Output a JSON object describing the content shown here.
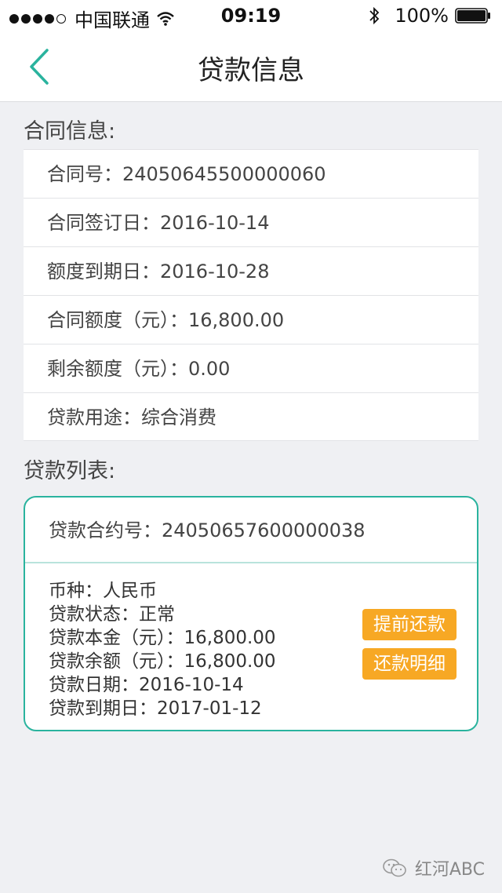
{
  "status_bar": {
    "carrier": "中国联通",
    "time": "09:19",
    "battery": "100%"
  },
  "nav": {
    "title": "贷款信息"
  },
  "contract": {
    "section_title": "合同信息:",
    "rows": [
      "合同号：24050645500000060",
      "合同签订日：2016-10-14",
      "额度到期日：2016-10-28",
      "合同额度（元）：16,800.00",
      "剩余额度（元）：0.00",
      "贷款用途：综合消费"
    ]
  },
  "loans": {
    "section_title": "贷款列表:",
    "items": [
      {
        "contract_no": "贷款合约号：24050657600000038",
        "details": [
          "币种：人民币",
          "贷款状态：正常",
          "贷款本金（元）：16,800.00",
          "贷款余额（元）：16,800.00",
          "贷款日期：2016-10-14",
          "贷款到期日：2017-01-12"
        ],
        "prepay_label": "提前还款",
        "detail_label": "还款明细"
      }
    ]
  },
  "watermark": {
    "text": "红河ABC"
  },
  "colors": {
    "accent": "#2ab39e",
    "button": "#f7a824",
    "background": "#eff0f3"
  }
}
